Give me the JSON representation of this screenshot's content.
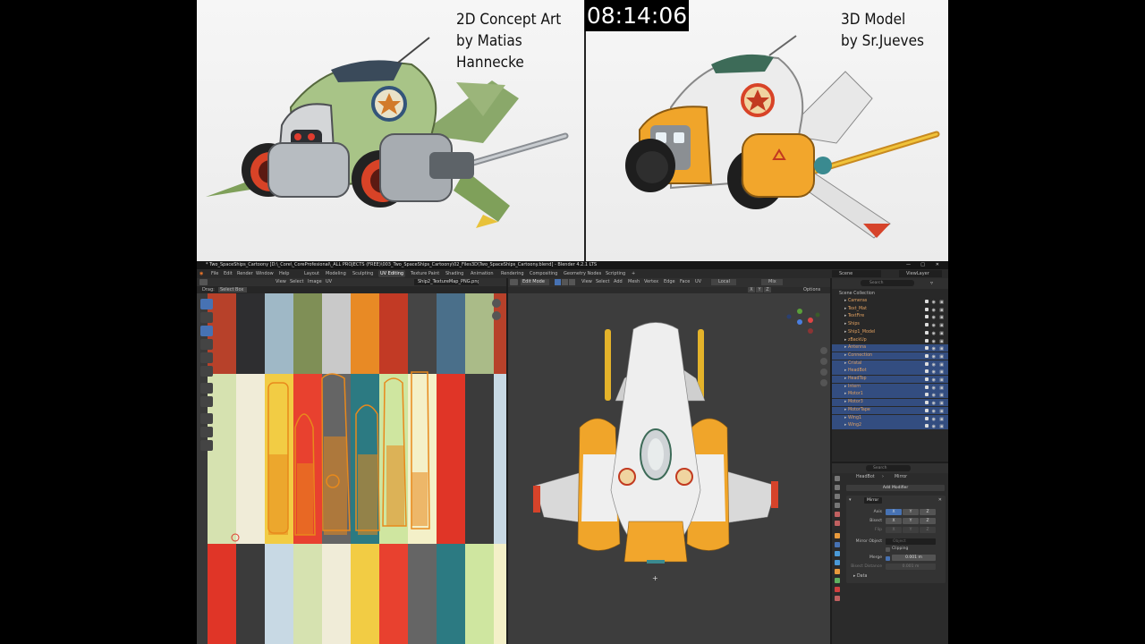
{
  "timer": "08:14:06",
  "captions": {
    "left_line1": "2D Concept Art",
    "left_line2": "by Matias Hannecke",
    "right_line1": "3D Model",
    "right_line2": "by Sr.Jueves"
  },
  "blender": {
    "title": "* Two_SpaceShips_Cartoony [D:\\_Core\\_CoreProfesional\\_ALL PROJECTS (FREE)\\003_Two_SpaceShips_Cartoony\\02_Files3D\\Two_SpaceShips_Cartoony.blend] - Blender 4.2.1 LTS",
    "menus": [
      "File",
      "Edit",
      "Render",
      "Window",
      "Help"
    ],
    "workspaces": [
      "Layout",
      "Modeling",
      "Sculpting",
      "UV Editing",
      "Texture Paint",
      "Shading",
      "Animation",
      "Rendering",
      "Compositing",
      "Geometry Nodes",
      "Scripting"
    ],
    "active_workspace": "UV Editing",
    "scene": "Scene",
    "view_layer": "ViewLayer",
    "uv_editor": {
      "menus": [
        "View",
        "Select",
        "Image",
        "UV"
      ],
      "image_name": "Ship2_TextureMap_PNG.png",
      "drag_label": "Drag:",
      "drag_value": "Select Box"
    },
    "viewport": {
      "mode": "Edit Mode",
      "menus": [
        "View",
        "Select",
        "Add",
        "Mesh",
        "Vertex",
        "Edge",
        "Face",
        "UV"
      ],
      "orientation": "Local",
      "pivot": "Mix",
      "axes": [
        "X",
        "Y",
        "Z"
      ],
      "options": "Options"
    },
    "outliner": {
      "search_placeholder": "Search",
      "root": "Scene Collection",
      "items": [
        {
          "name": "Cameras",
          "selected": false
        },
        {
          "name": "Text_Mat",
          "selected": false
        },
        {
          "name": "TextFire",
          "selected": false
        },
        {
          "name": "Ships",
          "selected": false
        },
        {
          "name": "Ship1_Model",
          "selected": false
        },
        {
          "name": "zBackUp",
          "selected": false
        },
        {
          "name": "Antenna",
          "selected": true
        },
        {
          "name": "Connection",
          "selected": true
        },
        {
          "name": "Cristal",
          "selected": true
        },
        {
          "name": "HeadBot",
          "selected": true
        },
        {
          "name": "HeadTop",
          "selected": true
        },
        {
          "name": "Intern",
          "selected": true
        },
        {
          "name": "Motor1",
          "selected": true
        },
        {
          "name": "Motor3",
          "selected": true
        },
        {
          "name": "MotorTape",
          "selected": true
        },
        {
          "name": "Wing1",
          "selected": true
        },
        {
          "name": "Wing2",
          "selected": true
        }
      ]
    },
    "properties": {
      "search_placeholder": "Search",
      "object": "HeadBot",
      "modifier_breadcrumb": "Mirror",
      "add_modifier": "Add Modifier",
      "modifier_name": "Mirror",
      "axis_label": "Axis",
      "bisect_label": "Bisect",
      "flip_label": "Flip",
      "axes": [
        "X",
        "Y",
        "Z"
      ],
      "mirror_object_label": "Mirror Object",
      "mirror_object_placeholder": "Object",
      "clipping_label": "Clipping",
      "merge_label": "Merge",
      "merge_value": "0.001 m",
      "bisect_distance_label": "Bisect Distance",
      "bisect_distance_value": "0.001 m",
      "data_label": "Data"
    }
  }
}
